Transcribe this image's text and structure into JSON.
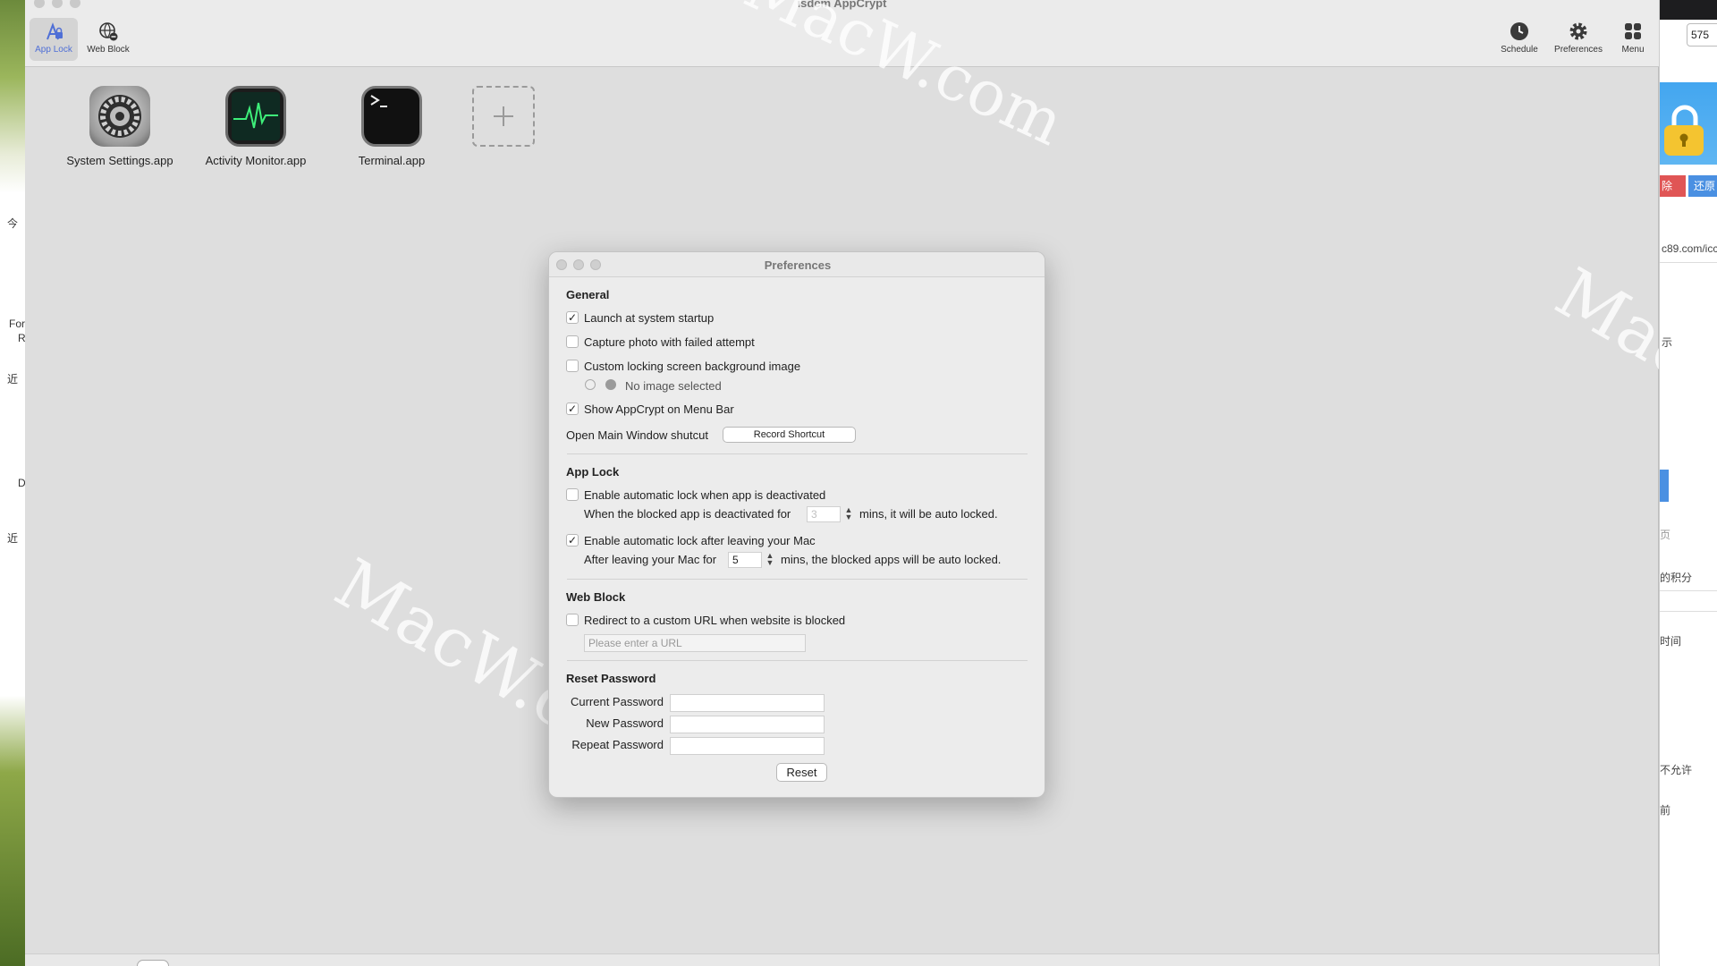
{
  "window": {
    "title": "isdem AppCrypt"
  },
  "toolbar": {
    "app_lock": "App Lock",
    "web_block": "Web Block",
    "schedule": "Schedule",
    "preferences": "Preferences",
    "menu": "Menu"
  },
  "apps": [
    {
      "name": "System Settings.app",
      "icon": "gear-icon"
    },
    {
      "name": "Activity Monitor.app",
      "icon": "activity-monitor-icon"
    },
    {
      "name": "Terminal.app",
      "icon": "terminal-icon"
    }
  ],
  "watermark": "MacW.com",
  "prefs": {
    "title": "Preferences",
    "general": {
      "title": "General",
      "launch_startup": "Launch at system startup",
      "launch_startup_checked": true,
      "capture_photo": "Capture photo with failed attempt",
      "capture_photo_checked": false,
      "custom_bg": "Custom locking screen background image",
      "custom_bg_checked": false,
      "no_image": "No image selected",
      "show_menubar": "Show AppCrypt on Menu Bar",
      "show_menubar_checked": true,
      "shortcut_label": "Open Main Window shutcut",
      "record_shortcut": "Record Shortcut"
    },
    "app_lock": {
      "title": "App Lock",
      "auto_deactivated": "Enable automatic lock when app is deactivated",
      "auto_deactivated_checked": false,
      "deactivated_prefix": "When the blocked app is deactivated for",
      "deactivated_value": "3",
      "deactivated_suffix": "mins, it will be auto locked.",
      "auto_leaving": "Enable automatic lock after leaving your Mac",
      "auto_leaving_checked": true,
      "leaving_prefix": "After leaving your Mac for",
      "leaving_value": "5",
      "leaving_suffix": "mins, the blocked apps will be auto locked."
    },
    "web_block": {
      "title": "Web Block",
      "redirect": "Redirect to a custom URL when website is blocked",
      "redirect_checked": false,
      "url_placeholder": "Please enter a URL"
    },
    "reset": {
      "title": "Reset Password",
      "current": "Current Password",
      "new": "New Password",
      "repeat": "Repeat Password",
      "button": "Reset"
    }
  },
  "desktop_left": {
    "items": [
      "今",
      "For",
      "R",
      "近",
      "D",
      "近"
    ]
  },
  "right_window": {
    "field_value": "575",
    "delete_btn": "除",
    "restore_btn": "还原",
    "url_frag": "c89.com/icc",
    "text_1": "示",
    "text_2": "页",
    "text_3": "的积分",
    "text_4": "时间",
    "text_5": "不允许",
    "text_6": "前"
  }
}
